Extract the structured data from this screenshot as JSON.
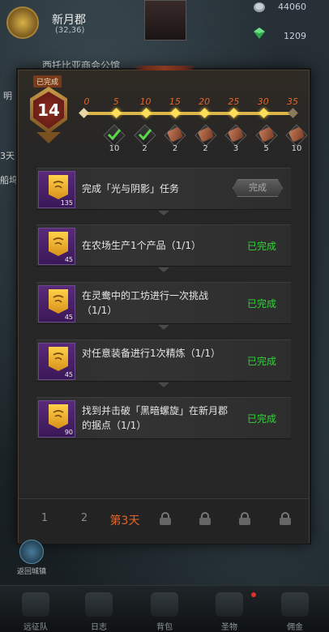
{
  "topbar": {
    "city_name": "新月郡",
    "city_coord": "(32,36)",
    "resource_1": "44060",
    "resource_2": "1209",
    "notice": "西托比亚商会公馆"
  },
  "side": {
    "chip_1": "明",
    "chip_2": "3天",
    "chip_3": "船坞"
  },
  "panel": {
    "done_tag": "已完成",
    "level": "14",
    "ticks": [
      "0",
      "5",
      "10",
      "15",
      "20",
      "25",
      "30",
      "35"
    ],
    "progress_reached_index": 4,
    "rewards": [
      {
        "icon": "check-icon",
        "count": "10",
        "claimed": true
      },
      {
        "icon": "check-icon",
        "count": "2",
        "claimed": true
      },
      {
        "icon": "scroll-icon",
        "count": "2",
        "claimed": false
      },
      {
        "icon": "scroll-icon",
        "count": "2",
        "claimed": false
      },
      {
        "icon": "scroll-icon",
        "count": "3",
        "claimed": false
      },
      {
        "icon": "scroll-icon",
        "count": "5",
        "claimed": false
      },
      {
        "icon": "scroll-icon",
        "count": "10",
        "claimed": false
      }
    ]
  },
  "tasks": [
    {
      "text": "完成「光与阴影」任务",
      "points": "135",
      "status": "",
      "button": "完成"
    },
    {
      "text": "在农场生产1个产品（1/1）",
      "points": "45",
      "status": "已完成",
      "button": ""
    },
    {
      "text": "在灵鸯中的工坊进行一次挑战（1/1）",
      "points": "45",
      "status": "已完成",
      "button": ""
    },
    {
      "text": "对任意装备进行1次精炼（1/1）",
      "points": "45",
      "status": "已完成",
      "button": ""
    },
    {
      "text": "找到并击破「黑暗螺旋」在新月郡的据点（1/1）",
      "points": "90",
      "status": "已完成",
      "button": ""
    }
  ],
  "days": {
    "day_1": "1",
    "day_2": "2",
    "day_3": "第3天",
    "locked_count": 4
  },
  "return": {
    "label": "返回城镇"
  },
  "nav": [
    {
      "label": "远征队",
      "icon": "helmet-icon"
    },
    {
      "label": "日志",
      "icon": "scroll-icon"
    },
    {
      "label": "背包",
      "icon": "bag-icon"
    },
    {
      "label": "圣物",
      "icon": "relic-icon"
    },
    {
      "label": "佣金",
      "icon": "swords-icon"
    }
  ],
  "colors": {
    "accent": "#e3652a",
    "complete": "#33d33a",
    "track": "#d9b54a"
  }
}
